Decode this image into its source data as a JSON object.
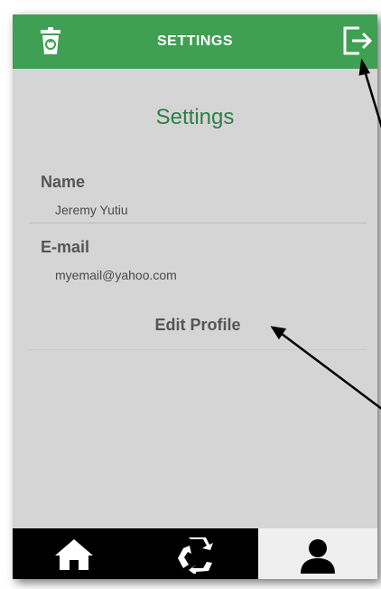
{
  "appbar": {
    "title": "SETTINGS",
    "left_icon": "trash-icon",
    "right_icon": "logout-icon",
    "color": "#3f9f53"
  },
  "settings": {
    "heading": "Settings",
    "name_label": "Name",
    "name_value": "Jeremy Yutiu",
    "email_label": "E-mail",
    "email_value": "myemail@yahoo.com",
    "edit_profile_label": "Edit Profile"
  },
  "bottom_nav": {
    "items": [
      {
        "icon": "home-icon",
        "active": false
      },
      {
        "icon": "recycle-icon",
        "active": false
      },
      {
        "icon": "profile-icon",
        "active": true
      }
    ]
  }
}
